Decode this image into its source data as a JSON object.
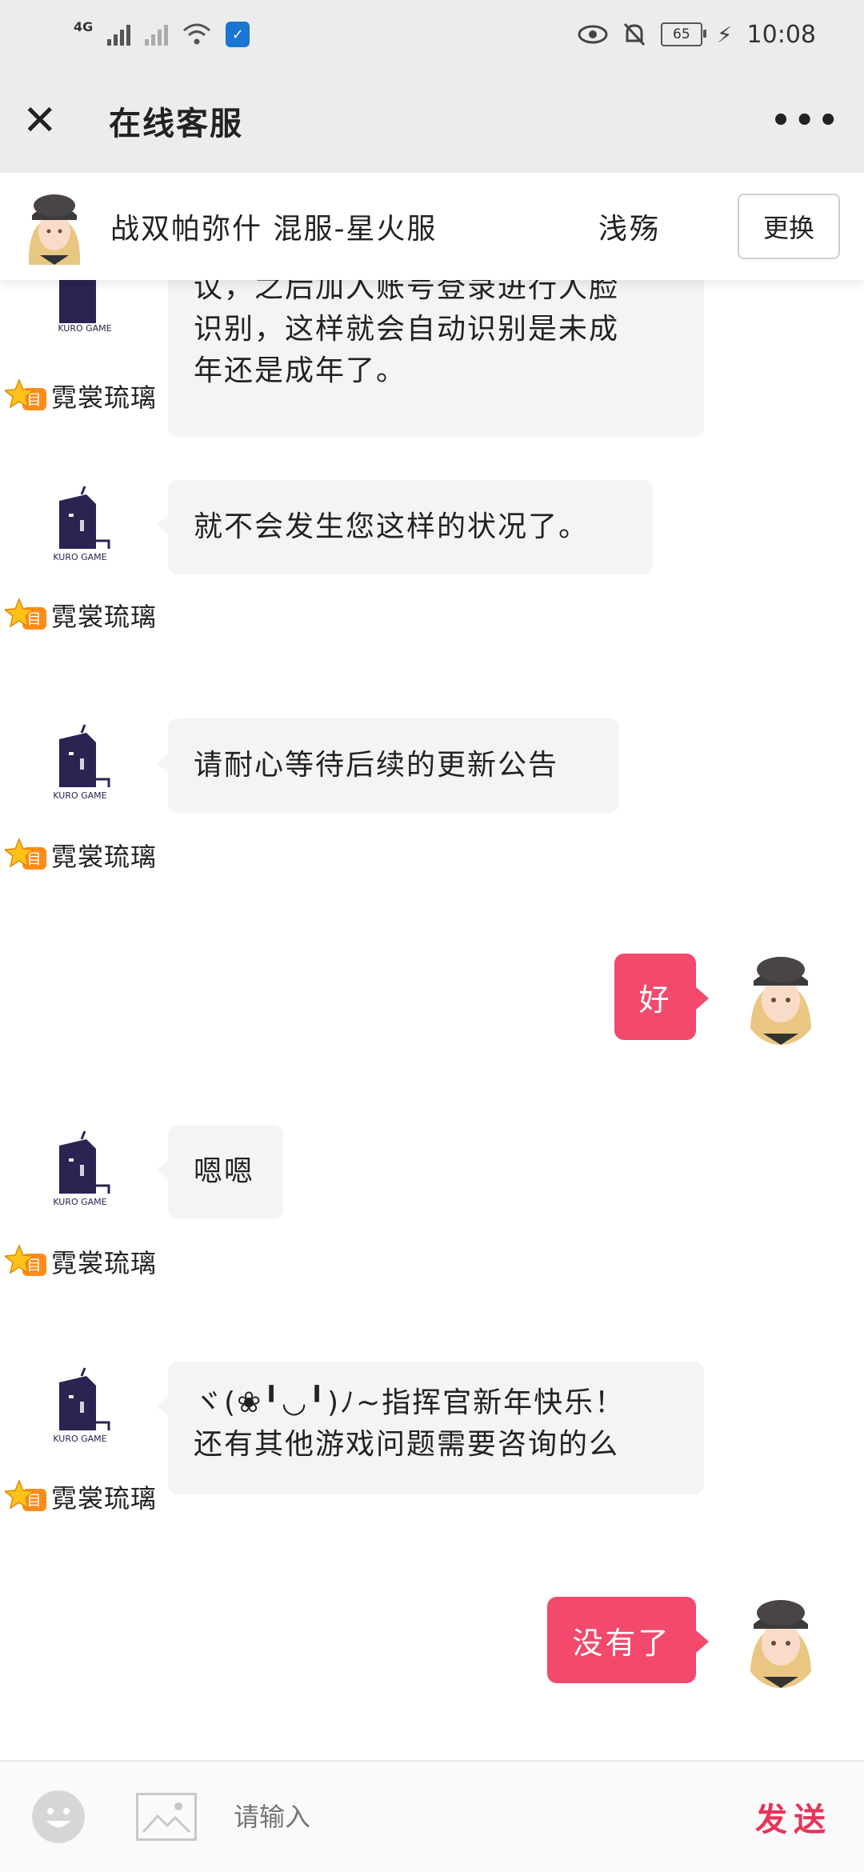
{
  "status_bar": {
    "network": "4G",
    "battery": "65",
    "time": "10:08"
  },
  "header": {
    "title": "在线客服"
  },
  "account": {
    "server_info": "战双帕弥什 混服-星火服",
    "role_name": "浅殇",
    "change_label": "更换"
  },
  "messages": [
    {
      "from": "agent",
      "name": "霓裳琉璃",
      "lines": [
        "议，之后加入账号登录进行人脸",
        "识别，这样就会自动识别是未成",
        "年还是成年了。"
      ]
    },
    {
      "from": "agent",
      "name": "霓裳琉璃",
      "lines": [
        "就不会发生您这样的状况了。"
      ]
    },
    {
      "from": "agent",
      "name": "霓裳琉璃",
      "lines": [
        "请耐心等待后续的更新公告"
      ]
    },
    {
      "from": "user",
      "text": "好"
    },
    {
      "from": "agent",
      "name": "霓裳琉璃",
      "lines": [
        "嗯嗯"
      ]
    },
    {
      "from": "agent",
      "name": "霓裳琉璃",
      "lines": [
        "ヾ(❀╹◡╹)ﾉ~指挥官新年快乐！",
        "还有其他游戏问题需要咨询的么"
      ]
    },
    {
      "from": "user",
      "text": "没有了"
    }
  ],
  "bot_logo_text": "KURO GAME",
  "input": {
    "placeholder": "请输入",
    "send_label": "发送"
  },
  "colors": {
    "accent": "#f2496c",
    "send_text": "#e8335a",
    "header_bg": "#ececec",
    "bubble_in": "#f4f4f4"
  },
  "icons": {
    "close": "close-icon",
    "more": "more-icon",
    "emoji": "emoji-icon",
    "image": "image-icon",
    "vip": "vip-star-icon"
  }
}
